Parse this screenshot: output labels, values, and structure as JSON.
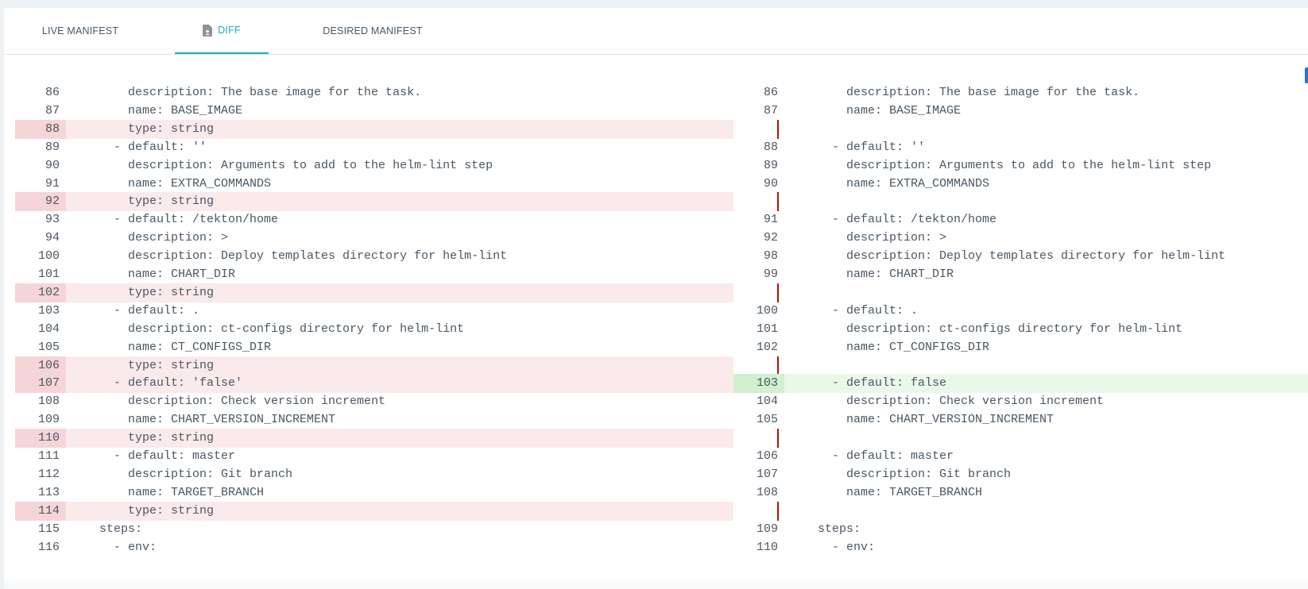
{
  "tabs": [
    {
      "label": "LIVE MANIFEST",
      "active": false
    },
    {
      "label": "DIFF",
      "active": true,
      "icon": "file-diff-icon"
    },
    {
      "label": "DESIRED MANIFEST",
      "active": false
    }
  ],
  "colors": {
    "accent": "#1aacbe",
    "removed_bg": "#fbeaeb",
    "removed_gutter": "#f6d5d8",
    "added_bg": "#e9f8e9",
    "added_gutter": "#d0f0cf",
    "gap_marker": "#b7110e"
  },
  "left": [
    {
      "n": "86",
      "t": "      description: The base image for the task."
    },
    {
      "n": "87",
      "t": "      name: BASE_IMAGE"
    },
    {
      "n": "88",
      "t": "      type: string",
      "k": "removed"
    },
    {
      "n": "89",
      "t": "    - default: ''"
    },
    {
      "n": "90",
      "t": "      description: Arguments to add to the helm-lint step"
    },
    {
      "n": "91",
      "t": "      name: EXTRA_COMMANDS"
    },
    {
      "n": "92",
      "t": "      type: string",
      "k": "removed"
    },
    {
      "n": "93",
      "t": "    - default: /tekton/home"
    },
    {
      "n": "94",
      "t": "      description: >"
    },
    {
      "n": "100",
      "t": "      description: Deploy templates directory for helm-lint"
    },
    {
      "n": "101",
      "t": "      name: CHART_DIR"
    },
    {
      "n": "102",
      "t": "      type: string",
      "k": "removed"
    },
    {
      "n": "103",
      "t": "    - default: ."
    },
    {
      "n": "104",
      "t": "      description: ct-configs directory for helm-lint"
    },
    {
      "n": "105",
      "t": "      name: CT_CONFIGS_DIR"
    },
    {
      "n": "106",
      "t": "      type: string",
      "k": "removed"
    },
    {
      "n": "107",
      "t": "    - default: 'false'",
      "k": "removed"
    },
    {
      "n": "108",
      "t": "      description: Check version increment"
    },
    {
      "n": "109",
      "t": "      name: CHART_VERSION_INCREMENT"
    },
    {
      "n": "110",
      "t": "      type: string",
      "k": "removed"
    },
    {
      "n": "111",
      "t": "    - default: master"
    },
    {
      "n": "112",
      "t": "      description: Git branch"
    },
    {
      "n": "113",
      "t": "      name: TARGET_BRANCH"
    },
    {
      "n": "114",
      "t": "      type: string",
      "k": "removed"
    },
    {
      "n": "115",
      "t": "  steps:"
    },
    {
      "n": "116",
      "t": "    - env:"
    }
  ],
  "right": [
    {
      "n": "86",
      "t": "      description: The base image for the task."
    },
    {
      "n": "87",
      "t": "      name: BASE_IMAGE"
    },
    {
      "n": "",
      "t": "",
      "k": "gap"
    },
    {
      "n": "88",
      "t": "    - default: ''"
    },
    {
      "n": "89",
      "t": "      description: Arguments to add to the helm-lint step"
    },
    {
      "n": "90",
      "t": "      name: EXTRA_COMMANDS"
    },
    {
      "n": "",
      "t": "",
      "k": "gap"
    },
    {
      "n": "91",
      "t": "    - default: /tekton/home"
    },
    {
      "n": "92",
      "t": "      description: >"
    },
    {
      "n": "98",
      "t": "      description: Deploy templates directory for helm-lint"
    },
    {
      "n": "99",
      "t": "      name: CHART_DIR"
    },
    {
      "n": "",
      "t": "",
      "k": "gap"
    },
    {
      "n": "100",
      "t": "    - default: ."
    },
    {
      "n": "101",
      "t": "      description: ct-configs directory for helm-lint"
    },
    {
      "n": "102",
      "t": "      name: CT_CONFIGS_DIR"
    },
    {
      "n": "",
      "t": "",
      "k": "gap"
    },
    {
      "n": "103",
      "t": "    - default: false",
      "k": "added"
    },
    {
      "n": "104",
      "t": "      description: Check version increment"
    },
    {
      "n": "105",
      "t": "      name: CHART_VERSION_INCREMENT"
    },
    {
      "n": "",
      "t": "",
      "k": "gap"
    },
    {
      "n": "106",
      "t": "    - default: master"
    },
    {
      "n": "107",
      "t": "      description: Git branch"
    },
    {
      "n": "108",
      "t": "      name: TARGET_BRANCH"
    },
    {
      "n": "",
      "t": "",
      "k": "gap"
    },
    {
      "n": "109",
      "t": "  steps:"
    },
    {
      "n": "110",
      "t": "    - env:"
    }
  ]
}
